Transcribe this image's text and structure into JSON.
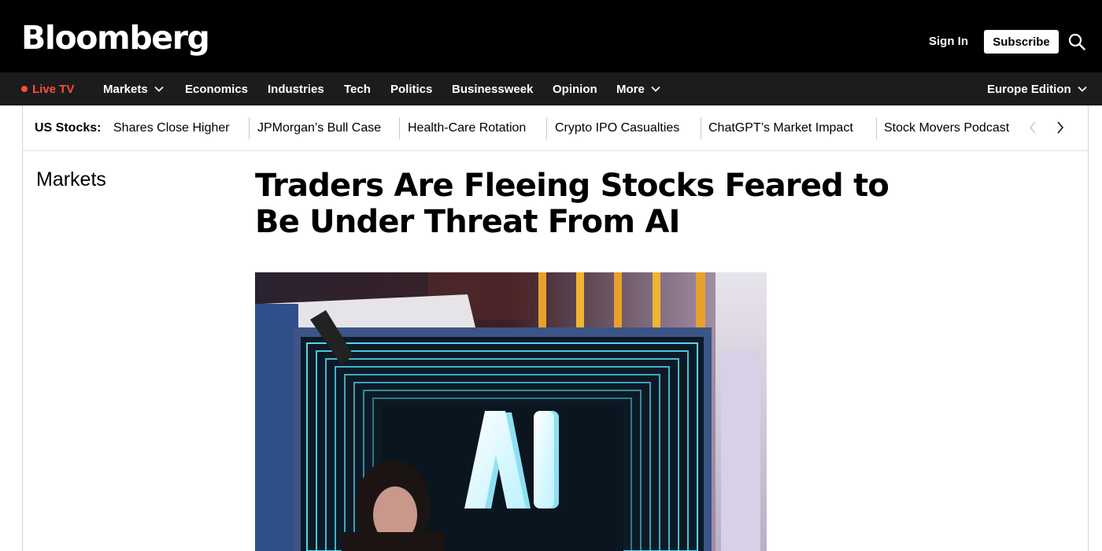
{
  "header": {
    "logo": "Bloomberg",
    "sign_in": "Sign In",
    "subscribe": "Subscribe",
    "search_icon": "search-icon"
  },
  "nav": {
    "live_tv": "Live TV",
    "items": [
      "Markets",
      "Economics",
      "Industries",
      "Tech",
      "Politics",
      "Businessweek",
      "Opinion",
      "More"
    ],
    "edition": "Europe Edition"
  },
  "ticker": {
    "label": "US Stocks:",
    "links": [
      "Shares Close Higher",
      "JPMorgan’s Bull Case",
      "Health-Care Rotation",
      "Crypto IPO Casualties",
      "ChatGPT’s Market Impact",
      "Stock Movers Podcast"
    ]
  },
  "article": {
    "section": "Markets",
    "headline": "Traders Are Fleeing Stocks Feared to Be Under Threat From AI",
    "image_text": "AI"
  },
  "colors": {
    "header_bg": "#000000",
    "nav_bg": "#1c1c1c",
    "live_accent": "#ff4d3a",
    "screen_glow": "#4fd8f0"
  }
}
